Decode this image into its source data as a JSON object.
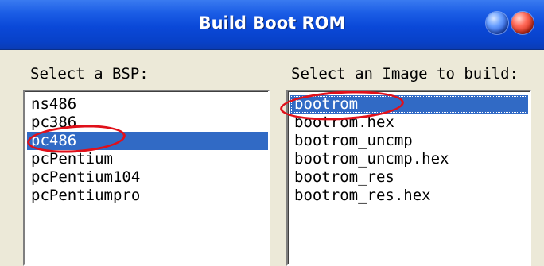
{
  "window": {
    "title": "Build Boot ROM",
    "controls": [
      "minimize-icon",
      "close-icon"
    ]
  },
  "bsp": {
    "label": "Select a BSP:",
    "items": [
      "ns486",
      "pc386",
      "pc486",
      "pcPentium",
      "pcPentium104",
      "pcPentiumpro"
    ],
    "selected": "pc486"
  },
  "image": {
    "label": "Select an Image to build:",
    "items": [
      "bootrom",
      "bootrom.hex",
      "bootrom_uncmp",
      "bootrom_uncmp.hex",
      "bootrom_res",
      "bootrom_res.hex"
    ],
    "selected": "bootrom"
  },
  "colors": {
    "titlebar": "#0a48d8",
    "selection": "#316ac5",
    "annotation": "#e0101a"
  }
}
